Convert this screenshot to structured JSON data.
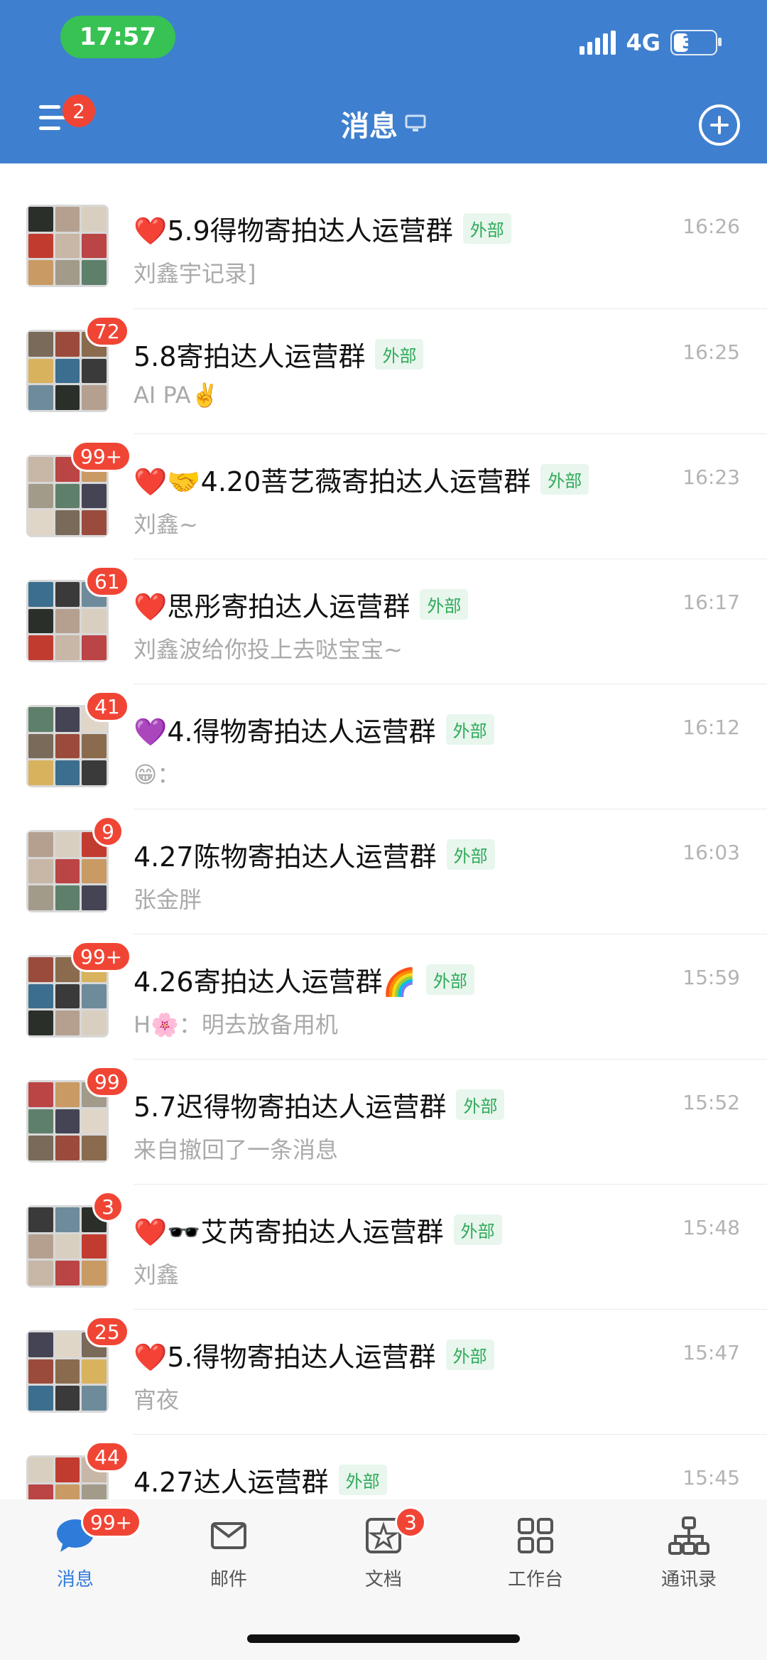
{
  "status_bar": {
    "time": "17:57",
    "network": "4G",
    "battery": "38",
    "battery_level": 0.38
  },
  "header": {
    "title": "消息",
    "menu_badge": "2"
  },
  "chats": [
    {
      "title_parts": [
        "❤️",
        "5.9",
        "得物寄拍达人运营群"
      ],
      "tag": "外部",
      "time": "16:26",
      "preview_parts": [
        "刘鑫宇",
        "记录]"
      ],
      "badge": ""
    },
    {
      "title_parts": [
        "5.8",
        "寄拍达人运营群"
      ],
      "tag": "外部",
      "time": "16:25",
      "preview_parts": [
        "AI PA",
        "✌️"
      ],
      "badge": "72"
    },
    {
      "title_parts": [
        "❤️🤝",
        "4.20",
        "菩艺薇寄拍达人运营群"
      ],
      "tag": "外部",
      "time": "16:23",
      "preview_parts": [
        "刘鑫",
        "~"
      ],
      "badge": "99+"
    },
    {
      "title_parts": [
        "❤️",
        "思彤寄拍达人运营群"
      ],
      "tag": "外部",
      "time": "16:17",
      "preview_parts": [
        "刘鑫",
        "波给你投上去哒宝宝~"
      ],
      "badge": "61"
    },
    {
      "title_parts": [
        "💜",
        "4.",
        "得物寄拍达人运营群"
      ],
      "tag": "外部",
      "time": "16:12",
      "preview_parts": [
        "😁",
        "："
      ],
      "badge": "41"
    },
    {
      "title_parts": [
        "4.27陈",
        "物寄拍达人运营群"
      ],
      "tag": "外部",
      "time": "16:03",
      "preview_parts": [
        "张金胖",
        ""
      ],
      "badge": "9"
    },
    {
      "title_parts": [
        "4.26",
        "寄拍达人运营群🌈"
      ],
      "tag": "外部",
      "time": "15:59",
      "preview_parts": [
        "H🌸：明",
        "去放备用机"
      ],
      "badge": "99+"
    },
    {
      "title_parts": [
        "5.7迟",
        "得物寄拍达人运营群"
      ],
      "tag": "外部",
      "time": "15:52",
      "preview_parts": [
        "来自",
        "撤回了一条消息"
      ],
      "badge": "99"
    },
    {
      "title_parts": [
        "❤️🕶️",
        "艾芮寄拍达人运营群"
      ],
      "tag": "外部",
      "time": "15:48",
      "preview_parts": [
        "刘鑫",
        ""
      ],
      "badge": "3"
    },
    {
      "title_parts": [
        "❤️",
        "5.",
        "得物寄拍达人运营群"
      ],
      "tag": "外部",
      "time": "15:47",
      "preview_parts": [
        "宵夜",
        ""
      ],
      "badge": "25"
    },
    {
      "title_parts": [
        "4.27",
        "达人运营群"
      ],
      "tag": "外部",
      "time": "15:45",
      "preview_parts": [
        "",
        ""
      ],
      "badge": "44"
    }
  ],
  "bottom_nav": [
    {
      "label": "消息",
      "icon": "chat-bubble-icon",
      "badge": "99+",
      "active": true
    },
    {
      "label": "邮件",
      "icon": "mail-icon",
      "badge": "",
      "active": false
    },
    {
      "label": "文档",
      "icon": "document-icon",
      "badge": "3",
      "active": false
    },
    {
      "label": "工作台",
      "icon": "grid-icon",
      "badge": "",
      "active": false
    },
    {
      "label": "通讯录",
      "icon": "org-chart-icon",
      "badge": "",
      "active": false
    }
  ],
  "colors": {
    "header_bg": "#3f7fcf",
    "badge": "#f04535",
    "external_tag": "#2faa5a",
    "active_nav": "#2f7bd9"
  }
}
